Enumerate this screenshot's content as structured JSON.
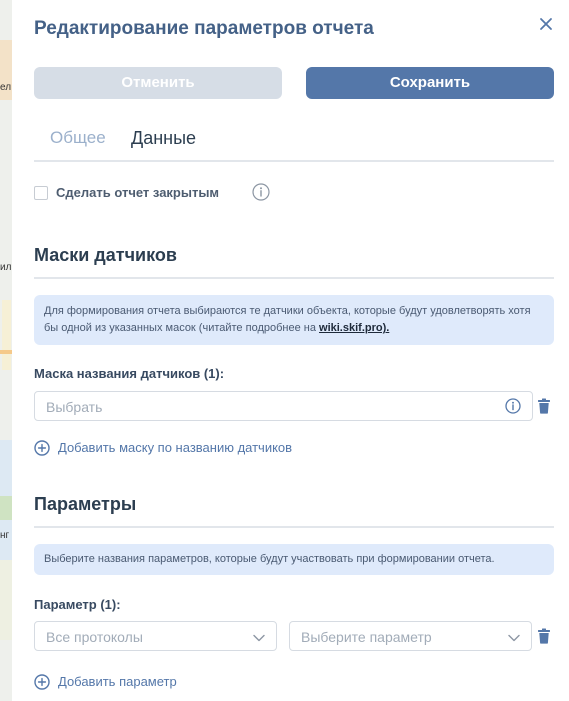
{
  "background_map": {
    "labels": [
      "ел",
      "ил",
      "нг"
    ]
  },
  "dialog": {
    "title": "Редактирование параметров отчета",
    "close_icon": "close-icon",
    "cancel_label": "Отменить",
    "save_label": "Сохранить"
  },
  "tabs": [
    {
      "label": "Общее",
      "active": false
    },
    {
      "label": "Данные",
      "active": true
    }
  ],
  "private_report": {
    "label": "Сделать отчет закрытым",
    "checked": false
  },
  "sensor_masks": {
    "title": "Маски датчиков",
    "note_text": "Для формирования отчета выбираются те датчики объекта, которые будут удовлетворять хотя бы одной из указанных масок (читайте подробнее на ",
    "note_link": "wiki.skif.pro).",
    "field_label": "Маска названия датчиков (1):",
    "input_placeholder": "Выбрать",
    "add_label": "Добавить маску по названию датчиков"
  },
  "parameters": {
    "title": "Параметры",
    "note_text": "Выберите названия параметров, которые будут участвовать при формировании отчета.",
    "field_label": "Параметр (1):",
    "protocol_placeholder": "Все протоколы",
    "param_placeholder": "Выберите параметр",
    "add_label": "Добавить параметр"
  },
  "colors": {
    "title": "#446187",
    "primary_button": "#5477a9",
    "disabled_button": "#d6dde6",
    "note_background": "#dfeafb",
    "link": "#5477a9"
  }
}
